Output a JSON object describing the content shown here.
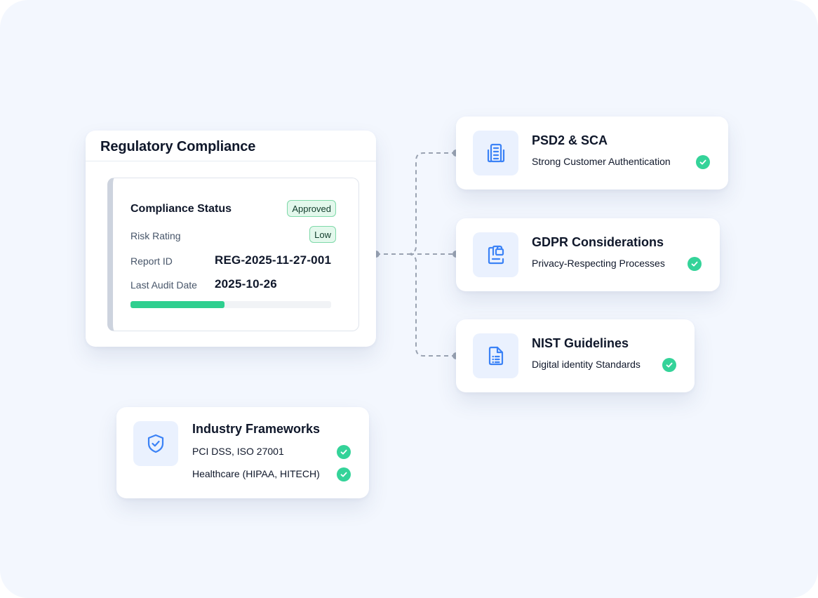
{
  "compliance": {
    "title": "Regulatory Compliance",
    "status_title": "Compliance Status",
    "status_badge": "Approved",
    "risk_label": "Risk Rating",
    "risk_badge": "Low",
    "report_label": "Report ID",
    "report_value": "REG-2025-11-27-001",
    "audit_label": "Last Audit Date",
    "audit_value": "2025-10-26",
    "progress_fraction": 0.47,
    "progress_color": "#2ecf8f"
  },
  "features": [
    {
      "title": "PSD2 & SCA",
      "subtitle": "Strong Customer Authentication",
      "icon": "building-icon",
      "checked": true
    },
    {
      "title": "GDPR Considerations",
      "subtitle": "Privacy-Respecting Processes",
      "icon": "document-lock-icon",
      "checked": true
    },
    {
      "title": "NIST Guidelines",
      "subtitle": "Digital identity Standards",
      "icon": "document-list-icon",
      "checked": true
    }
  ],
  "industry": {
    "title": "Industry Frameworks",
    "icon": "shield-check-icon",
    "items": [
      {
        "label": "PCI DSS, ISO 27001",
        "checked": true
      },
      {
        "label": "Healthcare (HIPAA, HITECH)",
        "checked": true
      }
    ]
  },
  "colors": {
    "accent_blue": "#3b82f6",
    "check_green": "#34d399",
    "background": "#f3f7fe"
  }
}
